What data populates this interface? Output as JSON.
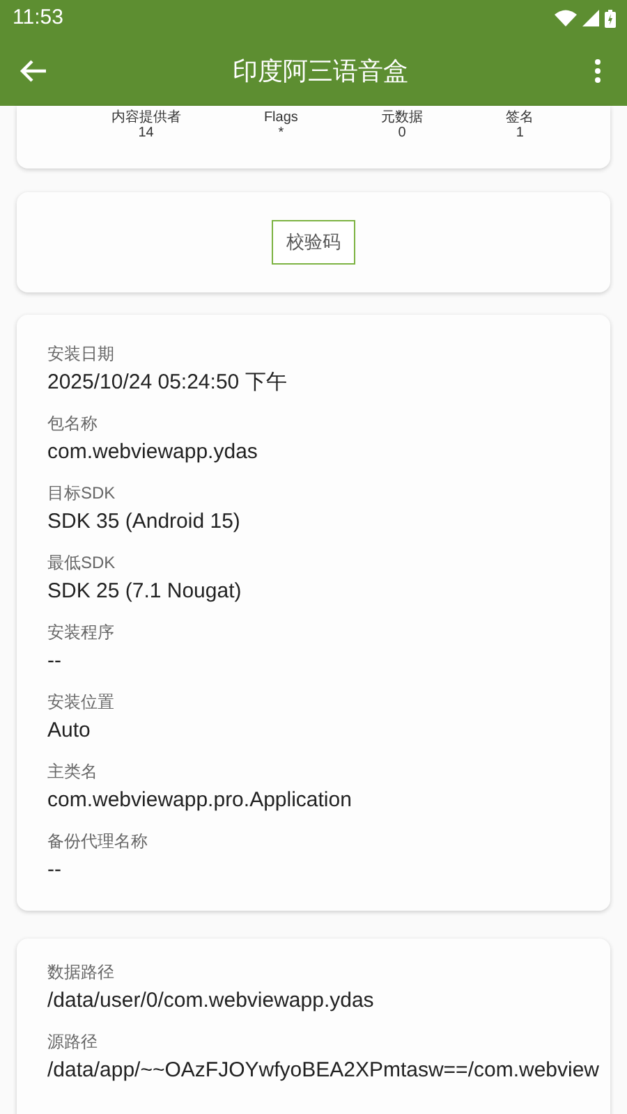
{
  "status_bar": {
    "time": "11:53"
  },
  "toolbar": {
    "title": "印度阿三语音盒"
  },
  "stats": [
    {
      "label": "内容提供者",
      "value": "14"
    },
    {
      "label": "Flags",
      "value": "*"
    },
    {
      "label": "元数据",
      "value": "0"
    },
    {
      "label": "签名",
      "value": "1"
    }
  ],
  "checksum_button": "校验码",
  "info": [
    {
      "label": "安装日期",
      "value": "2025/10/24 05:24:50 下午"
    },
    {
      "label": "包名称",
      "value": "com.webviewapp.ydas"
    },
    {
      "label": "目标SDK",
      "value": "SDK 35 (Android 15)"
    },
    {
      "label": "最低SDK",
      "value": "SDK 25 (7.1 Nougat)"
    },
    {
      "label": "安装程序",
      "value": "--"
    },
    {
      "label": "安装位置",
      "value": "Auto"
    },
    {
      "label": "主类名",
      "value": "com.webviewapp.pro.Application"
    },
    {
      "label": "备份代理名称",
      "value": "--"
    }
  ],
  "paths": [
    {
      "label": "数据路径",
      "value": "/data/user/0/com.webviewapp.ydas"
    },
    {
      "label": "源路径",
      "value": "/data/app/~~OAzFJOYwfyoBEA2XPmtasw==/com.webview"
    }
  ]
}
